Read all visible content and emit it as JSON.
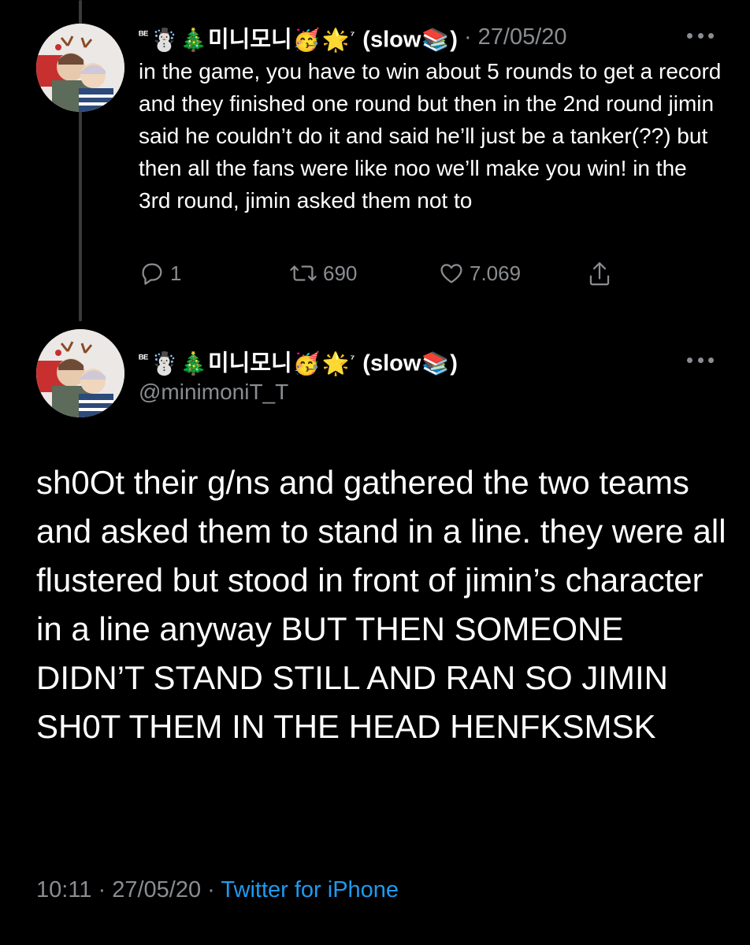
{
  "tweet_parent": {
    "display_name": "ᴮᴱ☃️🎄미니모니🥳🌟⁷ (slow📚)",
    "name_prefix": "ᴮᴱ",
    "name_core": "미니모니",
    "name_suffix": "⁷",
    "name_tail": "(slow",
    "name_close": ")",
    "emoji_snowman": "☃️",
    "emoji_tree": "🎄",
    "emoji_party": "🥳",
    "emoji_star": "🌟",
    "emoji_books": "📚",
    "separator": "·",
    "date": "27/05/20",
    "text": "in the game, you have to win about 5 rounds to get a record and they finished one round but then in the 2nd round jimin said he couldn’t do it and said he’ll just be a tanker(??) but then all the fans were like noo we’ll make you win! in the 3rd round, jimin asked them not to",
    "reply_count": "1",
    "retweet_count": "690",
    "like_count": "7.069"
  },
  "tweet_main": {
    "name_prefix": "ᴮᴱ",
    "name_core": "미니모니",
    "name_suffix": "⁷",
    "name_tail": "(slow",
    "name_close": ")",
    "emoji_snowman": "☃️",
    "emoji_tree": "🎄",
    "emoji_party": "🥳",
    "emoji_star": "🌟",
    "emoji_books": "📚",
    "handle": "@minimoniT_T",
    "text": "sh0Ot their g/ns and gathered the two teams and asked them to stand in a line. they were all flustered but stood in front of jimin’s character in a line anyway BUT THEN SOMEONE DIDN’T STAND STILL AND RAN SO JIMIN SH0T THEM IN THE HEAD HENFKSMSK",
    "time": "10:11",
    "separator": "·",
    "date": "27/05/20",
    "source": "Twitter for iPhone"
  },
  "icons": {
    "reply": "reply-icon",
    "retweet": "retweet-icon",
    "like": "heart-icon",
    "share": "share-icon",
    "more": "more-icon"
  },
  "colors": {
    "background": "#000000",
    "text_primary": "#ffffff",
    "text_secondary": "#8a8d91",
    "link": "#1d9bf0",
    "thread_line": "#3a3a3c"
  }
}
